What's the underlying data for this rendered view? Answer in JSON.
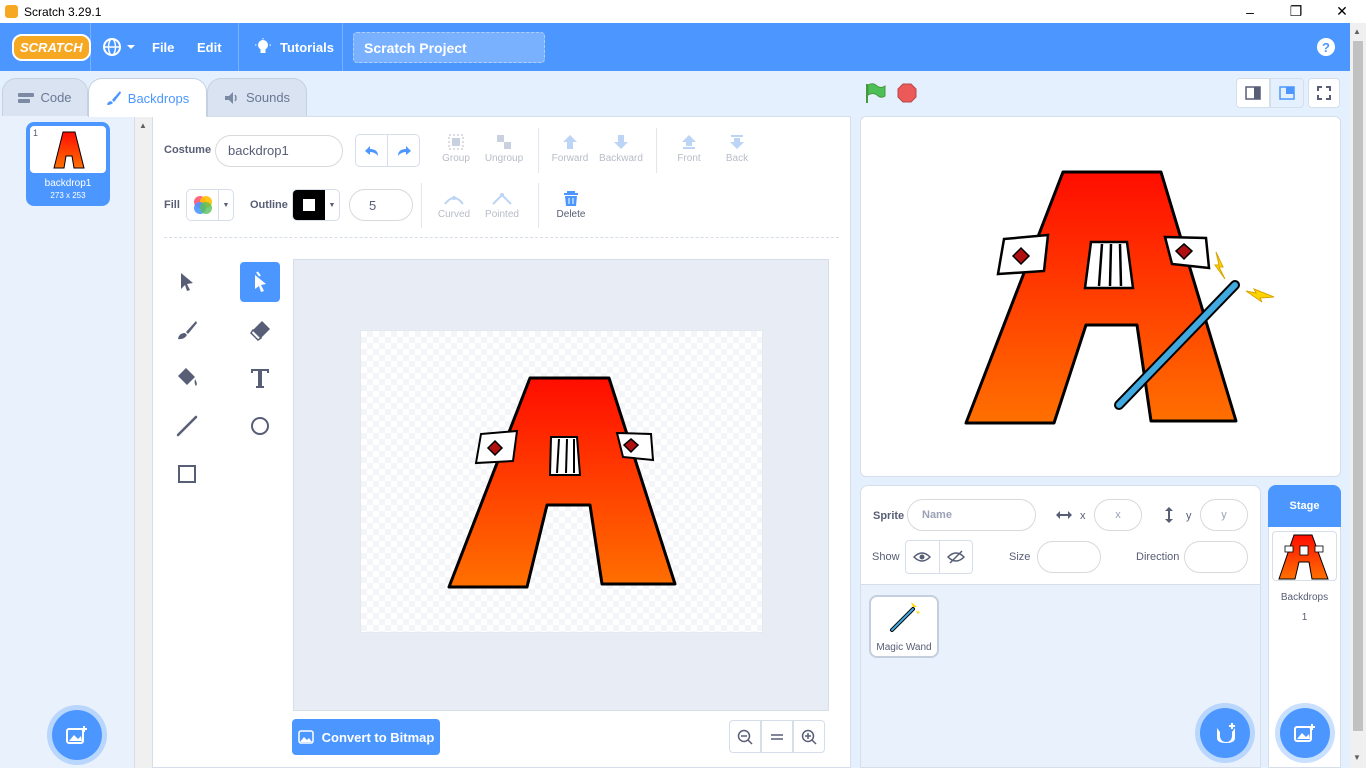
{
  "window": {
    "title": "Scratch 3.29.1",
    "minimize": "–",
    "maximize": "❐",
    "close": "✕"
  },
  "menubar": {
    "logo": "SCRATCH",
    "file": "File",
    "edit": "Edit",
    "tutorials": "Tutorials",
    "project_title": "Scratch Project",
    "help": "?"
  },
  "tabs": {
    "code": "Code",
    "backdrops": "Backdrops",
    "sounds": "Sounds"
  },
  "costumes": [
    {
      "index": "1",
      "name": "backdrop1",
      "size": "273 x 253"
    }
  ],
  "editor": {
    "costume_label": "Costume",
    "costume_name": "backdrop1",
    "group": "Group",
    "ungroup": "Ungroup",
    "forward": "Forward",
    "backward": "Backward",
    "front": "Front",
    "back": "Back",
    "fill_label": "Fill",
    "outline_label": "Outline",
    "outline_width": "5",
    "curved": "Curved",
    "pointed": "Pointed",
    "delete": "Delete",
    "convert": "Convert to Bitmap"
  },
  "sprite_info": {
    "sprite_label": "Sprite",
    "name_placeholder": "Name",
    "x_label": "x",
    "x_placeholder": "x",
    "y_label": "y",
    "y_placeholder": "y",
    "show_label": "Show",
    "size_label": "Size",
    "direction_label": "Direction"
  },
  "sprites": [
    {
      "name": "Magic Wand"
    }
  ],
  "stage_panel": {
    "title": "Stage",
    "backdrops_label": "Backdrops",
    "backdrops_count": "1"
  },
  "colors": {
    "accent": "#4c97ff",
    "letter_top": "#ff0d00",
    "letter_bottom": "#ff7000",
    "flag": "#4cbf56",
    "stop": "#ec5959",
    "wand": "#3fa9e0"
  }
}
